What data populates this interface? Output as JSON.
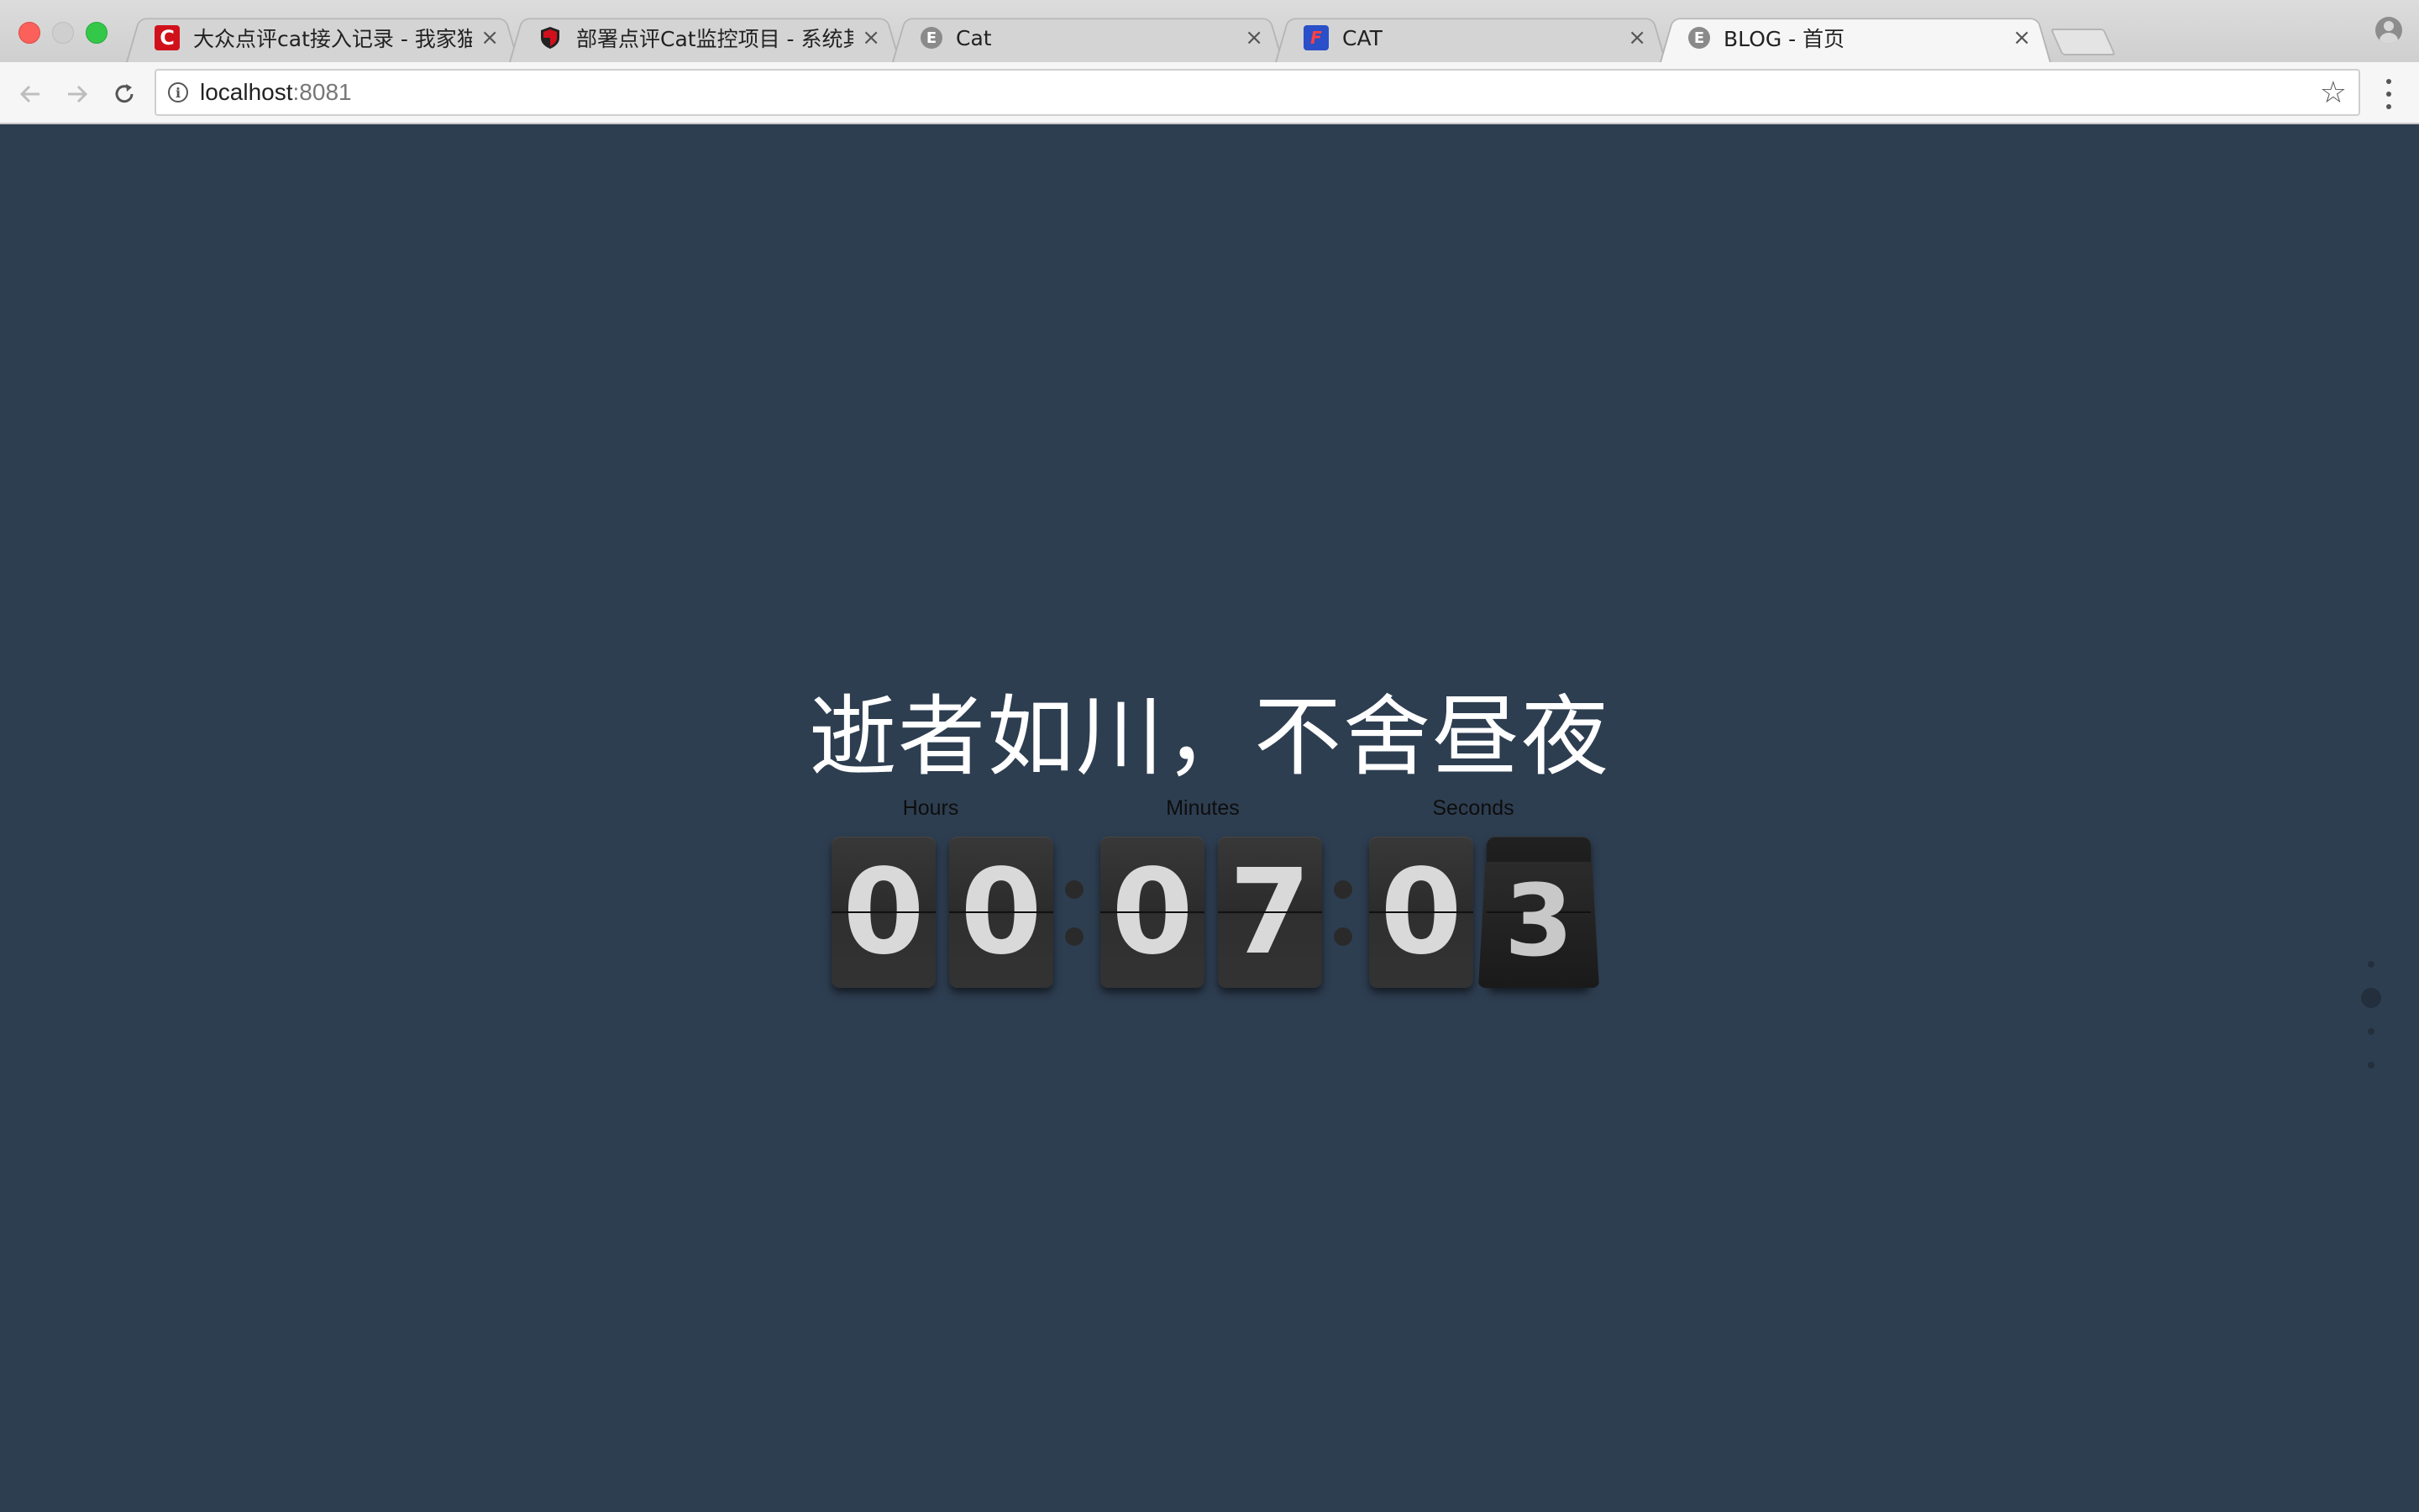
{
  "browser": {
    "tabs": [
      {
        "title": "大众点评cat接入记录 - 我家猫叫",
        "icon": "c-logo-icon",
        "active": false
      },
      {
        "title": "部署点评Cat监控项目 - 系统其他",
        "icon": "shield-icon",
        "active": false
      },
      {
        "title": "Cat",
        "icon": "e-logo-icon",
        "active": false
      },
      {
        "title": "CAT",
        "icon": "cat-logo-icon",
        "active": false
      },
      {
        "title": "BLOG - 首页",
        "icon": "e-logo-icon",
        "active": true
      }
    ],
    "close_glyph": "×",
    "url_host": "localhost",
    "url_port": ":8081"
  },
  "page": {
    "headline": "逝者如川，不舍昼夜",
    "clock": {
      "labels": {
        "hours": "Hours",
        "minutes": "Minutes",
        "seconds": "Seconds"
      },
      "digits": {
        "h1": "0",
        "h2": "0",
        "m1": "0",
        "m2": "7",
        "s1": "0",
        "s2": "3"
      }
    }
  },
  "colors": {
    "page_background": "#2e3e51",
    "headline": "#ffffff",
    "card": "#333333",
    "digit": "#d9d9d9"
  }
}
